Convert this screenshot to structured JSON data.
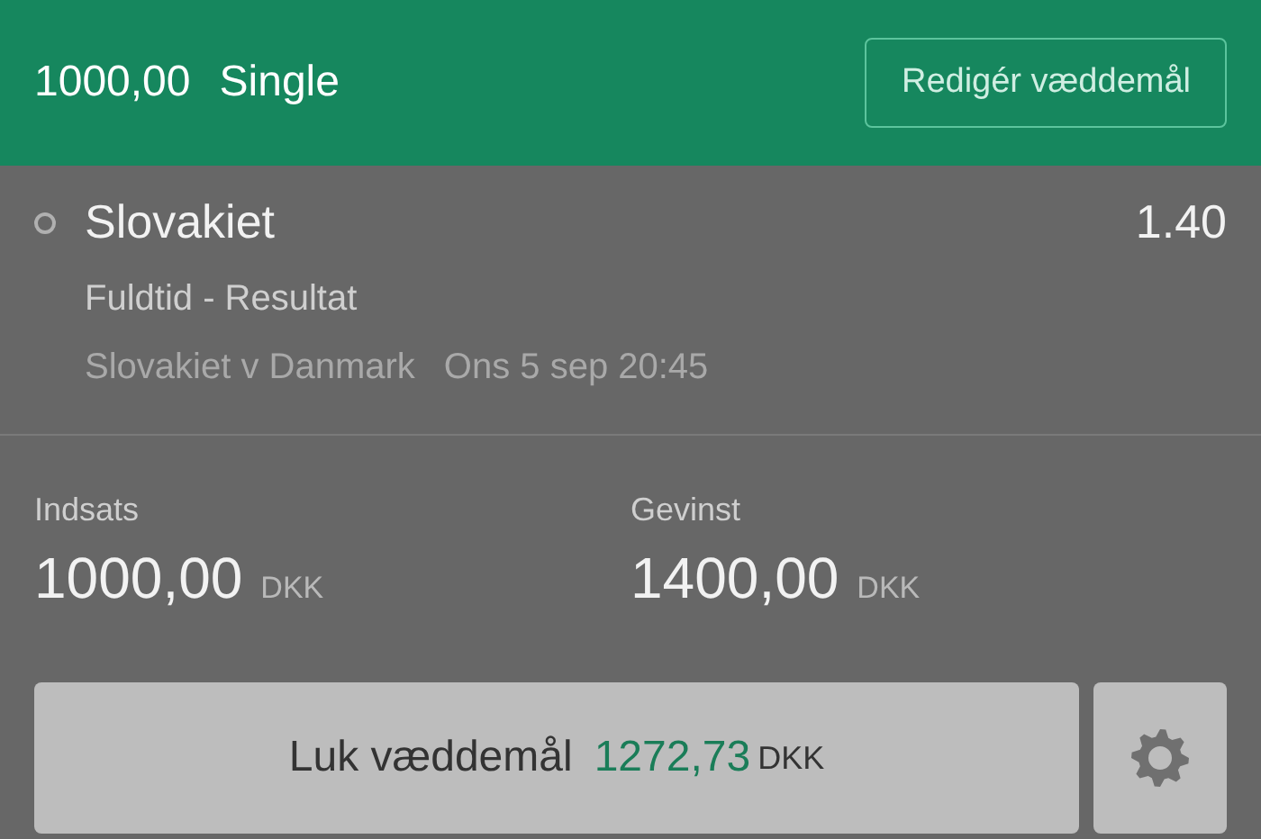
{
  "header": {
    "stake": "1000,00",
    "bet_type": "Single",
    "edit_button": "Redigér væddemål"
  },
  "selections": [
    {
      "name": "Slovakiet",
      "odds": "1.40",
      "market": "Fuldtid - Resultat",
      "event": "Slovakiet v Danmark",
      "time": "Ons 5 sep 20:45"
    }
  ],
  "totals": [
    {
      "label": "Indsats",
      "amount": "1000,00",
      "currency": "DKK"
    },
    {
      "label": "Gevinst",
      "amount": "1400,00",
      "currency": "DKK"
    }
  ],
  "cashout_button": {
    "label": "Luk væddemål",
    "amount": "1272,73",
    "currency": "DKK"
  }
}
